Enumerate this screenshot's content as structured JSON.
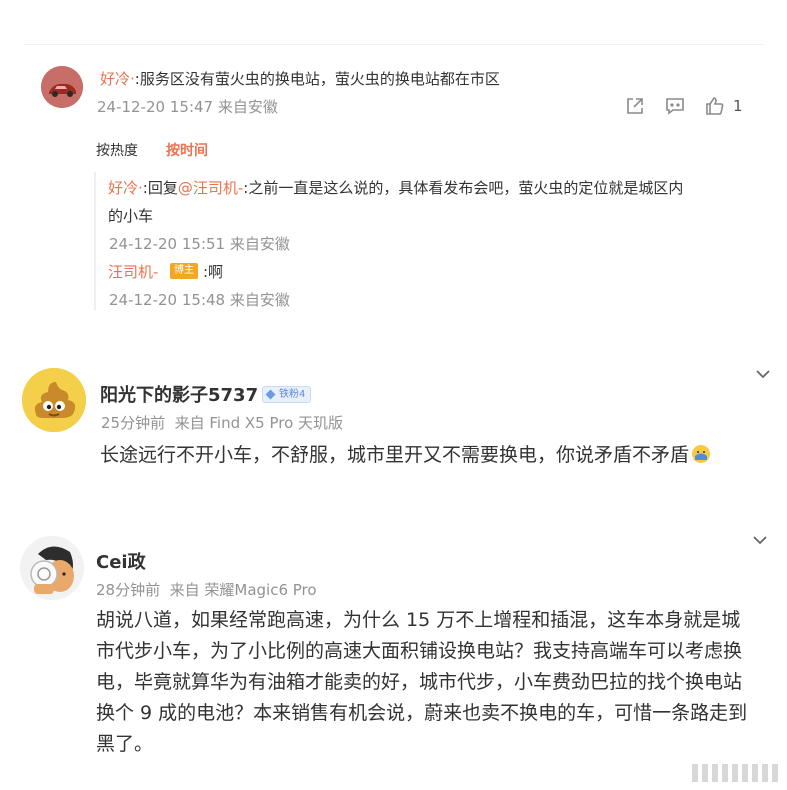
{
  "comment1": {
    "user": "好冷·",
    "text": ":服务区没有萤火虫的换电站，萤火虫的换电站都在市区",
    "meta": "24-12-20 15:47 来自安徽",
    "like_count": "1",
    "avatar_icon": "red-car-avatar"
  },
  "sort": {
    "by_heat": "按热度",
    "by_time": "按时间",
    "active_color": "#eb7350"
  },
  "replies": [
    {
      "user": "好冷·",
      "prefix": ":回复",
      "mention": "@汪司机-",
      "text_line1": ":之前一直是这么说的，具体看发布会吧，萤火虫的定位就是城区内",
      "text_line2": "的小车",
      "meta": "24-12-20 15:51 来自安徽"
    },
    {
      "user": "汪司机-",
      "badge": "博主",
      "text": ":啊",
      "meta": "24-12-20 15:48 来自安徽"
    }
  ],
  "comment2": {
    "user": "阳光下的影子5737",
    "badge": "铁粉4",
    "meta": "25分钟前  来自 Find X5 Pro 天玑版",
    "text": "长途远行不开小车，不舒服，城市里开又不需要换电，你说矛盾不矛盾",
    "avatar_icon": "poop-emoji-avatar",
    "emoji_icon": "facepalm-emoji"
  },
  "comment3": {
    "user": "Cei政",
    "meta": "28分钟前  来自 荣耀Magic6 Pro",
    "lines": [
      "胡说八道，如果经常跑高速，为什么 15 万不上增程和插混，这车本身就是城",
      "市代步小车，为了小比例的高速大面积铺设换电站？我支持高端车可以考虑换",
      "电，毕竟就算华为有油箱才能卖的好，城市代步，小车费劲巴拉的找个换电站",
      "换个 9 成的电池？本来销售有机会说，蔚来也卖不换电的车，可惜一条路走到",
      "黑了。"
    ],
    "avatar_icon": "cartoon-man-avatar"
  },
  "colors": {
    "accent": "#eb7350",
    "meta": "#939393",
    "text": "#333333"
  }
}
